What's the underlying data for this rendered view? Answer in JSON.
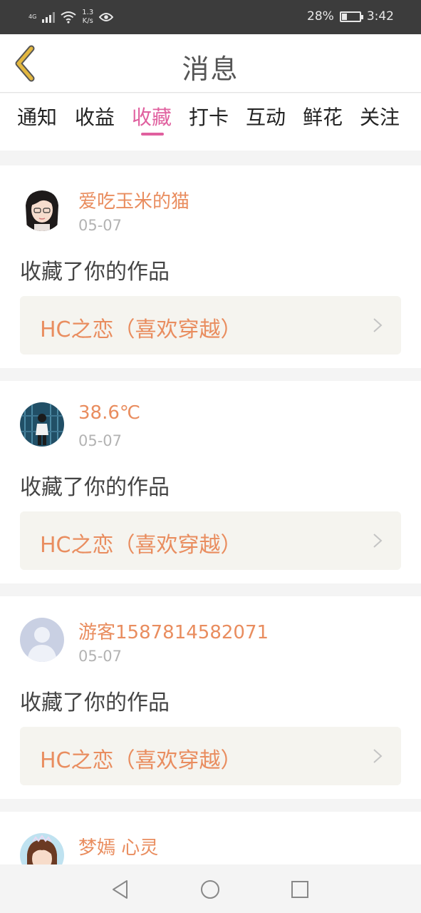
{
  "status_bar": {
    "network": "4G",
    "speed_value": "1.3",
    "speed_unit": "K/s",
    "battery": "28%",
    "battery_level": 0.28,
    "time": "3:42"
  },
  "header": {
    "title": "消息"
  },
  "tabs": [
    {
      "label": "通知"
    },
    {
      "label": "收益"
    },
    {
      "label": "收藏"
    },
    {
      "label": "打卡"
    },
    {
      "label": "互动"
    },
    {
      "label": "鲜花"
    },
    {
      "label": "关注"
    }
  ],
  "active_tab": "收藏",
  "messages": [
    {
      "user": "爱吃玉米的猫",
      "date": "05-07",
      "action": "收藏了你的作品",
      "work": "HC之恋（喜欢穿越）"
    },
    {
      "user": "38.6℃",
      "date": "05-07",
      "action": "收藏了你的作品",
      "work": "HC之恋（喜欢穿越）"
    },
    {
      "user": "游客1587814582071",
      "date": "05-07",
      "action": "收藏了你的作品",
      "work": "HC之恋（喜欢穿越）"
    },
    {
      "user": "梦嫣 心灵"
    }
  ],
  "colors": {
    "accent": "#e0609f",
    "username": "#e98d5f",
    "back_arrow": "#e3b73f"
  }
}
